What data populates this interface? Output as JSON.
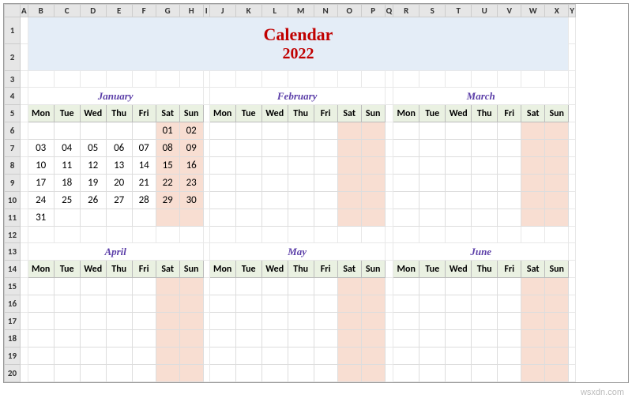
{
  "columns": [
    "A",
    "B",
    "C",
    "D",
    "E",
    "F",
    "G",
    "H",
    "I",
    "J",
    "K",
    "L",
    "M",
    "N",
    "O",
    "P",
    "Q",
    "R",
    "S",
    "T",
    "U",
    "V",
    "W",
    "X",
    "Y"
  ],
  "rows": [
    "1",
    "2",
    "3",
    "4",
    "5",
    "6",
    "7",
    "8",
    "9",
    "10",
    "11",
    "12",
    "13",
    "14",
    "15",
    "16",
    "17",
    "18",
    "19",
    "20"
  ],
  "title": "Calendar",
  "year": "2022",
  "days": [
    "Mon",
    "Tue",
    "Wed",
    "Thu",
    "Fri",
    "Sat",
    "Sun"
  ],
  "months": [
    {
      "name": "January",
      "weeks": [
        [
          "",
          "",
          "",
          "",
          "",
          "01",
          "02"
        ],
        [
          "03",
          "04",
          "05",
          "06",
          "07",
          "08",
          "09"
        ],
        [
          "10",
          "11",
          "12",
          "13",
          "14",
          "15",
          "16"
        ],
        [
          "17",
          "18",
          "19",
          "20",
          "21",
          "22",
          "23"
        ],
        [
          "24",
          "25",
          "26",
          "27",
          "28",
          "29",
          "30"
        ],
        [
          "31",
          "",
          "",
          "",
          "",
          "",
          ""
        ]
      ]
    },
    {
      "name": "February",
      "weeks": [
        [
          "",
          "",
          "",
          "",
          "",
          "",
          ""
        ],
        [
          "",
          "",
          "",
          "",
          "",
          "",
          ""
        ],
        [
          "",
          "",
          "",
          "",
          "",
          "",
          ""
        ],
        [
          "",
          "",
          "",
          "",
          "",
          "",
          ""
        ],
        [
          "",
          "",
          "",
          "",
          "",
          "",
          ""
        ],
        [
          "",
          "",
          "",
          "",
          "",
          "",
          ""
        ]
      ]
    },
    {
      "name": "March",
      "weeks": [
        [
          "",
          "",
          "",
          "",
          "",
          "",
          ""
        ],
        [
          "",
          "",
          "",
          "",
          "",
          "",
          ""
        ],
        [
          "",
          "",
          "",
          "",
          "",
          "",
          ""
        ],
        [
          "",
          "",
          "",
          "",
          "",
          "",
          ""
        ],
        [
          "",
          "",
          "",
          "",
          "",
          "",
          ""
        ],
        [
          "",
          "",
          "",
          "",
          "",
          "",
          ""
        ]
      ]
    },
    {
      "name": "April",
      "weeks": [
        [
          "",
          "",
          "",
          "",
          "",
          "",
          ""
        ],
        [
          "",
          "",
          "",
          "",
          "",
          "",
          ""
        ],
        [
          "",
          "",
          "",
          "",
          "",
          "",
          ""
        ],
        [
          "",
          "",
          "",
          "",
          "",
          "",
          ""
        ],
        [
          "",
          "",
          "",
          "",
          "",
          "",
          ""
        ],
        [
          "",
          "",
          "",
          "",
          "",
          "",
          ""
        ]
      ]
    },
    {
      "name": "May",
      "weeks": [
        [
          "",
          "",
          "",
          "",
          "",
          "",
          ""
        ],
        [
          "",
          "",
          "",
          "",
          "",
          "",
          ""
        ],
        [
          "",
          "",
          "",
          "",
          "",
          "",
          ""
        ],
        [
          "",
          "",
          "",
          "",
          "",
          "",
          ""
        ],
        [
          "",
          "",
          "",
          "",
          "",
          "",
          ""
        ],
        [
          "",
          "",
          "",
          "",
          "",
          "",
          ""
        ]
      ]
    },
    {
      "name": "June",
      "weeks": [
        [
          "",
          "",
          "",
          "",
          "",
          "",
          ""
        ],
        [
          "",
          "",
          "",
          "",
          "",
          "",
          ""
        ],
        [
          "",
          "",
          "",
          "",
          "",
          "",
          ""
        ],
        [
          "",
          "",
          "",
          "",
          "",
          "",
          ""
        ],
        [
          "",
          "",
          "",
          "",
          "",
          "",
          ""
        ],
        [
          "",
          "",
          "",
          "",
          "",
          "",
          ""
        ]
      ]
    }
  ],
  "watermark": "wsxdn.com"
}
